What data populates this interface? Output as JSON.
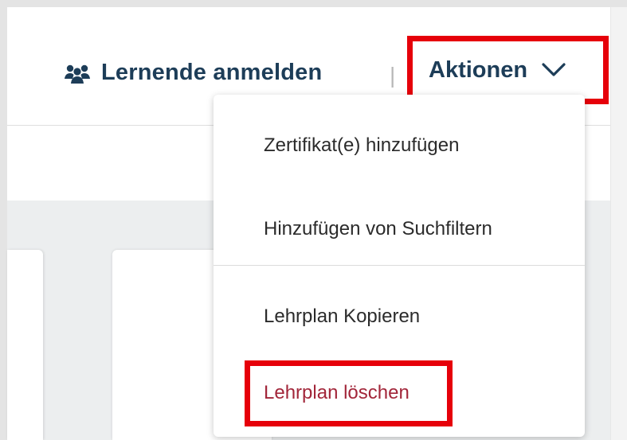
{
  "header": {
    "enroll_label": "Lernende anmelden",
    "enroll_icon": "users-icon",
    "separator": "|",
    "actions_label": "Aktionen",
    "actions_icon": "chevron-down-icon"
  },
  "menu": {
    "items": [
      {
        "label": "Zertifikat(e) hinzufügen"
      },
      {
        "label": "Hinzufügen von Suchfiltern"
      },
      {
        "label": "Lehrplan Kopieren"
      },
      {
        "label": "Lehrplan löschen"
      }
    ]
  },
  "colors": {
    "brand_text": "#1d3d58",
    "highlight_border": "#e6000a",
    "delete_text": "#a2263a"
  }
}
